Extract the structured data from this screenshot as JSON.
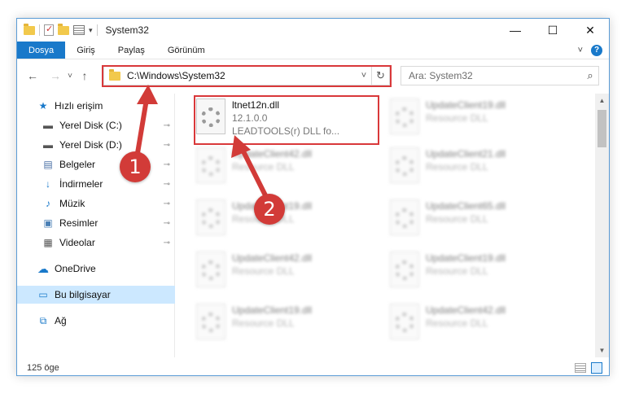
{
  "titlebar": {
    "title": "System32",
    "minimize": "—",
    "maximize": "☐",
    "close": "✕"
  },
  "ribbon": {
    "tabs": [
      "Dosya",
      "Giriş",
      "Paylaş",
      "Görünüm"
    ],
    "collapse_icon": "˅",
    "help_icon": "?"
  },
  "nav": {
    "back_icon": "←",
    "forward_icon": "→",
    "recent_icon": "˅",
    "up_icon": "↑",
    "address": "C:\\Windows\\System32",
    "address_dropdown_icon": "˅",
    "refresh_icon": "↻",
    "search_placeholder": "Ara: System32",
    "search_icon": "⌕"
  },
  "sidebar": {
    "items": [
      {
        "label": "Hızlı erişim",
        "icon": "★",
        "pinned": false
      },
      {
        "label": "Yerel Disk (C:)",
        "icon": "▬",
        "pinned": true
      },
      {
        "label": "Yerel Disk (D:)",
        "icon": "▬",
        "pinned": true
      },
      {
        "label": "Belgeler",
        "icon": "▤",
        "pinned": true
      },
      {
        "label": "İndirmeler",
        "icon": "↓",
        "pinned": true
      },
      {
        "label": "Müzik",
        "icon": "♪",
        "pinned": true
      },
      {
        "label": "Resimler",
        "icon": "▣",
        "pinned": true
      },
      {
        "label": "Videolar",
        "icon": "▦",
        "pinned": true
      },
      {
        "label": "OneDrive",
        "icon": "☁",
        "pinned": false
      },
      {
        "label": "Bu bilgisayar",
        "icon": "▭",
        "pinned": false
      },
      {
        "label": "Ağ",
        "icon": "⧉",
        "pinned": false
      }
    ],
    "pin_icon": "⊸"
  },
  "files": [
    {
      "name": "ltnet12n.dll",
      "line2": "12.1.0.0",
      "line3": "LEADTOOLS(r) DLL fo...",
      "blurred": false
    },
    {
      "name": "UpdateClient19.dll",
      "line2": "Resource DLL",
      "line3": "",
      "blurred": true
    },
    {
      "name": "UpdateClient42.dll",
      "line2": "Resource DLL",
      "line3": "",
      "blurred": true
    },
    {
      "name": "UpdateClient21.dll",
      "line2": "Resource DLL",
      "line3": "",
      "blurred": true
    },
    {
      "name": "UpdateClient19.dll",
      "line2": "Resource DLL",
      "line3": "",
      "blurred": true
    },
    {
      "name": "UpdateClient65.dll",
      "line2": "Resource DLL",
      "line3": "",
      "blurred": true
    },
    {
      "name": "UpdateClient42.dll",
      "line2": "Resource DLL",
      "line3": "",
      "blurred": true
    },
    {
      "name": "UpdateClient19.dll",
      "line2": "Resource DLL",
      "line3": "",
      "blurred": true
    },
    {
      "name": "UpdateClient19.dll",
      "line2": "Resource DLL",
      "line3": "",
      "blurred": true
    },
    {
      "name": "UpdateClient42.dll",
      "line2": "Resource DLL",
      "line3": "",
      "blurred": true
    }
  ],
  "scrollbar": {
    "up_icon": "▲",
    "down_icon": "▼"
  },
  "status": {
    "count": "125 öge"
  },
  "callouts": [
    {
      "number": "1",
      "color": "#d23b38"
    },
    {
      "number": "2",
      "color": "#d23b38"
    }
  ]
}
